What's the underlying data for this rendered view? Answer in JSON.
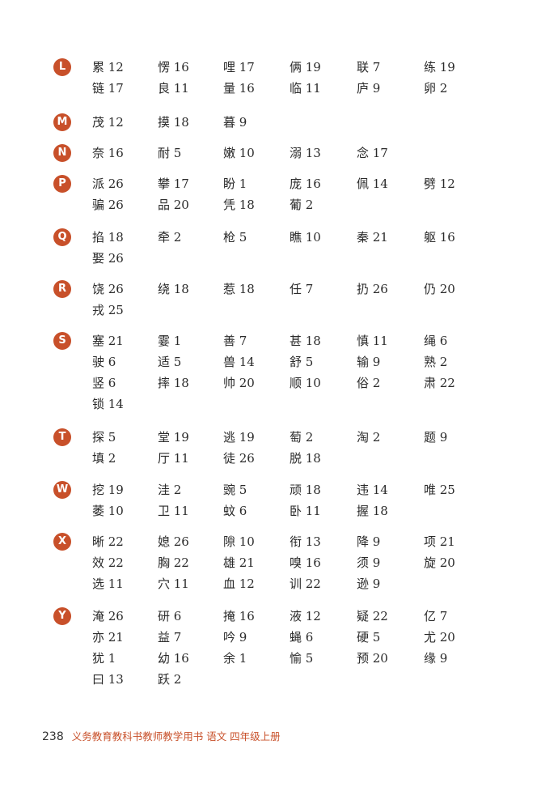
{
  "sections": [
    {
      "letter": "L",
      "rows": [
        [
          "累 12",
          "愣 16",
          "哩 17",
          "俩 19",
          "联 7",
          "练 19"
        ],
        [
          "链 17",
          "良 11",
          "量 16",
          "临 11",
          "庐 9",
          "卵 2"
        ]
      ]
    },
    {
      "letter": "M",
      "rows": [
        [
          "茂 12",
          "摸 18",
          "暮 9"
        ]
      ]
    },
    {
      "letter": "N",
      "rows": [
        [
          "奈 16",
          "耐 5",
          "嫩 10",
          "溺 13",
          "念 17"
        ]
      ]
    },
    {
      "letter": "P",
      "rows": [
        [
          "派 26",
          "攀 17",
          "盼 1",
          "庞 16",
          "佩 14",
          "劈 12"
        ],
        [
          "骗 26",
          "品 20",
          "凭 18",
          "葡 2"
        ]
      ]
    },
    {
      "letter": "Q",
      "rows": [
        [
          "掐 18",
          "牵 2",
          "枪 5",
          "瞧 10",
          "秦 21",
          "躯 16"
        ],
        [
          "娶 26"
        ]
      ]
    },
    {
      "letter": "R",
      "rows": [
        [
          "饶 26",
          "绕 18",
          "惹 18",
          "任 7",
          "扔 26",
          "仍 20"
        ],
        [
          "戎 25"
        ]
      ]
    },
    {
      "letter": "S",
      "rows": [
        [
          "塞 21",
          "霎 1",
          "善 7",
          "甚 18",
          "慎 11",
          "绳 6"
        ],
        [
          "驶 6",
          "适 5",
          "兽 14",
          "舒 5",
          "输 9",
          "熟 2"
        ],
        [
          "竖 6",
          "摔 18",
          "帅 20",
          "顺 10",
          "俗 2",
          "肃 22"
        ],
        [
          "锁 14"
        ]
      ]
    },
    {
      "letter": "T",
      "rows": [
        [
          "探 5",
          "堂 19",
          "逃 19",
          "萄 2",
          "淘 2",
          "题 9"
        ],
        [
          "填 2",
          "厅 11",
          "徒 26",
          "脱 18"
        ]
      ]
    },
    {
      "letter": "W",
      "rows": [
        [
          "挖 19",
          "洼 2",
          "豌 5",
          "顽 18",
          "违 14",
          "唯 25"
        ],
        [
          "萎 10",
          "卫 11",
          "蚊 6",
          "卧 11",
          "握 18"
        ]
      ]
    },
    {
      "letter": "X",
      "rows": [
        [
          "晰 22",
          "媳 26",
          "隙 10",
          "衔 13",
          "降 9",
          "项 21"
        ],
        [
          "效 22",
          "胸 22",
          "雄 21",
          "嗅 16",
          "须 9",
          "旋 20"
        ],
        [
          "选 11",
          "穴 11",
          "血 12",
          "训 22",
          "逊 9"
        ]
      ]
    },
    {
      "letter": "Y",
      "rows": [
        [
          "淹 26",
          "研 6",
          "掩 16",
          "液 12",
          "疑 22",
          "亿 7"
        ],
        [
          "亦 21",
          "益 7",
          "吟 9",
          "蝇 6",
          "硬 5",
          "尤 20"
        ],
        [
          "犹 1",
          "幼 16",
          "余 1",
          "愉 5",
          "预 20",
          "缘 9"
        ],
        [
          "曰 13",
          "跃 2"
        ]
      ]
    }
  ],
  "footer": {
    "page_number": "238",
    "text": "义务教育教科书教师教学用书  语文  四年级上册"
  }
}
